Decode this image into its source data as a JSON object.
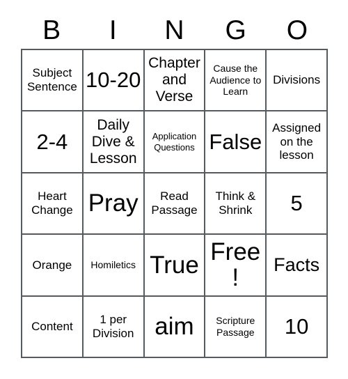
{
  "card": {
    "title": "BINGO",
    "columns": [
      "B",
      "I",
      "N",
      "G",
      "O"
    ],
    "colors": {
      "background": "#ffffff",
      "cell_background": "#ffffff",
      "border": "#555a5e",
      "text": "#000000"
    },
    "rows": [
      [
        {
          "text": "Subject Sentence",
          "size": "md"
        },
        {
          "text": "10-20",
          "size": "2xl"
        },
        {
          "text": "Chapter and Verse",
          "size": "lg"
        },
        {
          "text": "Cause the Audience to Learn",
          "size": "sm"
        },
        {
          "text": "Divisions",
          "size": "md"
        }
      ],
      [
        {
          "text": "2-4",
          "size": "2xl"
        },
        {
          "text": "Daily Dive & Lesson",
          "size": "lg"
        },
        {
          "text": "Application Questions",
          "size": "xs"
        },
        {
          "text": "False",
          "size": "2xl"
        },
        {
          "text": "Assigned on the lesson",
          "size": "md"
        }
      ],
      [
        {
          "text": "Heart Change",
          "size": "md"
        },
        {
          "text": "Pray",
          "size": "3xl"
        },
        {
          "text": "Read Passage",
          "size": "md"
        },
        {
          "text": "Think & Shrink",
          "size": "md"
        },
        {
          "text": "5",
          "size": "2xl"
        }
      ],
      [
        {
          "text": "Orange",
          "size": "md"
        },
        {
          "text": "Homiletics",
          "size": "sm"
        },
        {
          "text": "True",
          "size": "3xl"
        },
        {
          "text": "Free!",
          "size": "3xl"
        },
        {
          "text": "Facts",
          "size": "xl"
        }
      ],
      [
        {
          "text": "Content",
          "size": "md"
        },
        {
          "text": "1 per Division",
          "size": "md"
        },
        {
          "text": "aim",
          "size": "3xl"
        },
        {
          "text": "Scripture Passage",
          "size": "sm"
        },
        {
          "text": "10",
          "size": "2xl"
        }
      ]
    ]
  }
}
